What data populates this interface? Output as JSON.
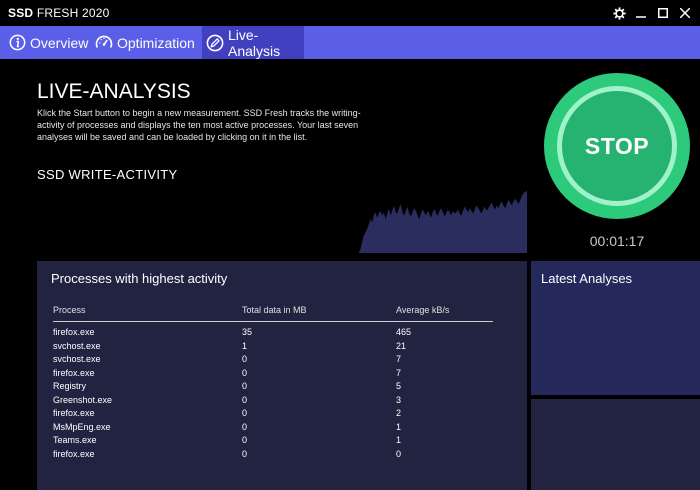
{
  "window": {
    "title_bold": "SSD",
    "title_rest": " FRESH 2020"
  },
  "nav": {
    "tabs": [
      {
        "label": "Overview",
        "icon": "info-icon"
      },
      {
        "label": "Optimization",
        "icon": "gauge-icon"
      },
      {
        "label": "Live-Analysis",
        "icon": "pencil-icon"
      }
    ],
    "active": "Live-Analysis"
  },
  "main": {
    "title": "LIVE-ANALYSIS",
    "description": "Klick the Start button to begin a new measurement. SSD Fresh tracks the writing-activity of processes and displays the ten most active processes. Your last seven analyses will be saved and can be loaded by clicking on it in the list.",
    "section_title": "SSD WRITE-ACTIVITY"
  },
  "stop": {
    "label": "STOP",
    "timer": "00:01:17"
  },
  "processes": {
    "title": "Processes with highest activity",
    "headers": [
      "Process",
      "Total data in MB",
      "Average kB/s"
    ],
    "rows": [
      [
        "firefox.exe",
        "35",
        "465"
      ],
      [
        "svchost.exe",
        "1",
        "21"
      ],
      [
        "svchost.exe",
        "0",
        "7"
      ],
      [
        "firefox.exe",
        "0",
        "7"
      ],
      [
        "Registry",
        "0",
        "5"
      ],
      [
        "Greenshot.exe",
        "0",
        "3"
      ],
      [
        "firefox.exe",
        "0",
        "2"
      ],
      [
        "MsMpEng.exe",
        "0",
        "1"
      ],
      [
        "Teams.exe",
        "0",
        "1"
      ],
      [
        "firefox.exe",
        "0",
        "0"
      ]
    ]
  },
  "latest": {
    "title": "Latest Analyses"
  },
  "colors": {
    "nav_bg": "#5b5fe8",
    "nav_active": "#4040c0",
    "stop_green": "#2eca7c",
    "chart_fill": "#2a2d5e",
    "panel": "#212341"
  },
  "activity": [
    0,
    0,
    0,
    0,
    0,
    0,
    0,
    0,
    0,
    0,
    0,
    0,
    0,
    0,
    0,
    0,
    0,
    0,
    0,
    0,
    0,
    0,
    0,
    0,
    0,
    0,
    0,
    0,
    0,
    0,
    0,
    0,
    0,
    0,
    0,
    0,
    0,
    0,
    0,
    0,
    0,
    0,
    0,
    0,
    0,
    0,
    0,
    0,
    0,
    0,
    0,
    0,
    0,
    0,
    0,
    0,
    0,
    0,
    0,
    0,
    0,
    0,
    0,
    0,
    0,
    0,
    0,
    0,
    0,
    0,
    0,
    0,
    0,
    0,
    0,
    0,
    0,
    0,
    0,
    0,
    0,
    0,
    0,
    0,
    0,
    0,
    0,
    0,
    0,
    0,
    0,
    0,
    0,
    0,
    0,
    0,
    0,
    0,
    0,
    0,
    0,
    0,
    0,
    0,
    0,
    0,
    0,
    0,
    0,
    0,
    0,
    0,
    0,
    0,
    0,
    0,
    0,
    0,
    0,
    0,
    0,
    0,
    0,
    0,
    0,
    0,
    0,
    0,
    0,
    0,
    0,
    0,
    0,
    0,
    0,
    0,
    0,
    0,
    0,
    0,
    0,
    0,
    0,
    0,
    0,
    0,
    0,
    0,
    0,
    0,
    0,
    0,
    0,
    0,
    0,
    0,
    0,
    0,
    0,
    0,
    0,
    0,
    0,
    0,
    0,
    0,
    0,
    0,
    0,
    0,
    0,
    0,
    0,
    0,
    0,
    0,
    0,
    0,
    0,
    0,
    0,
    0,
    0,
    0,
    0,
    0,
    0,
    0,
    0,
    0,
    0,
    0,
    0.05,
    0.15,
    0.25,
    0.3,
    0.35,
    0.42,
    0.5,
    0.45,
    0.55,
    0.6,
    0.52,
    0.58,
    0.62,
    0.55,
    0.6,
    0.5,
    0.58,
    0.65,
    0.55,
    0.62,
    0.7,
    0.6,
    0.58,
    0.66,
    0.72,
    0.6,
    0.55,
    0.62,
    0.68,
    0.58,
    0.54,
    0.6,
    0.66,
    0.62,
    0.56,
    0.5,
    0.58,
    0.64,
    0.6,
    0.55,
    0.62,
    0.58,
    0.52,
    0.6,
    0.65,
    0.58,
    0.55,
    0.62,
    0.66,
    0.6,
    0.54,
    0.58,
    0.64,
    0.6,
    0.56,
    0.62,
    0.58,
    0.6,
    0.64,
    0.58,
    0.55,
    0.62,
    0.68,
    0.64,
    0.6,
    0.66,
    0.62,
    0.58,
    0.64,
    0.7,
    0.66,
    0.62,
    0.58,
    0.64,
    0.68,
    0.62,
    0.66,
    0.7,
    0.74,
    0.68,
    0.64,
    0.7,
    0.66,
    0.72,
    0.76,
    0.7,
    0.66,
    0.72,
    0.78,
    0.74,
    0.7,
    0.76,
    0.8,
    0.76,
    0.72,
    0.78,
    0.84,
    0.88,
    0.9,
    0.92
  ]
}
